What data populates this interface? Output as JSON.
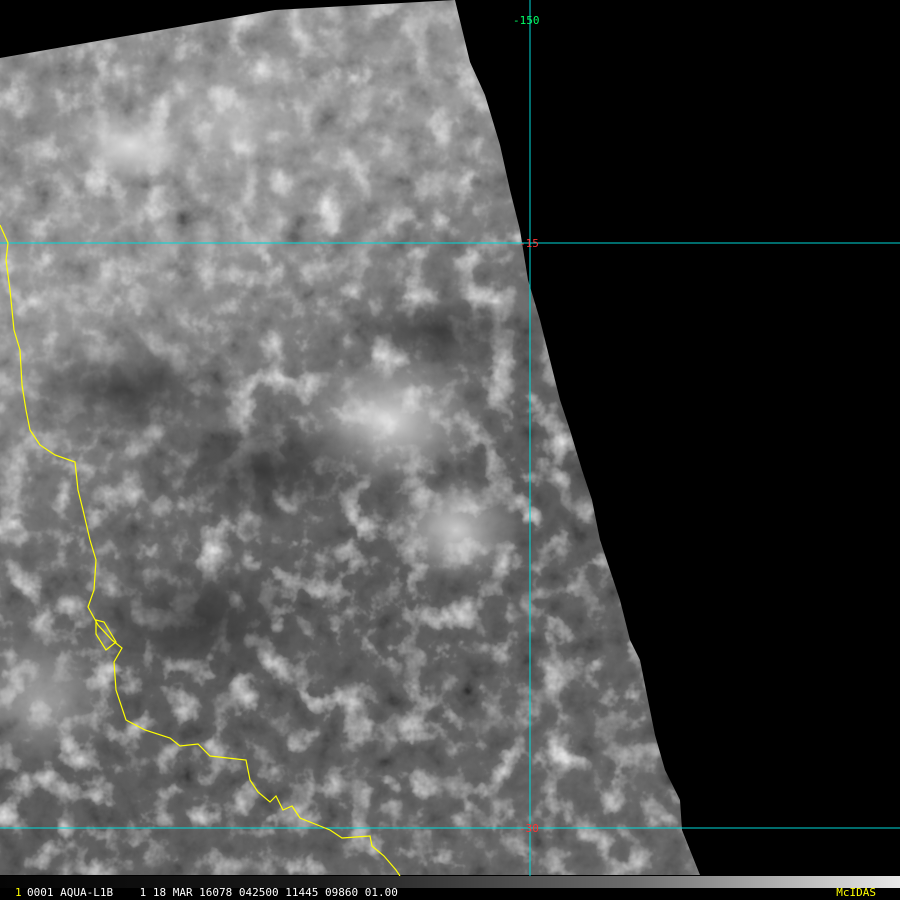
{
  "map": {
    "longitude_labels": [
      {
        "text": "-150",
        "color": "#00ff66"
      }
    ],
    "latitude_labels": [
      {
        "text": "-15",
        "color": "#ff3333"
      },
      {
        "text": "-30",
        "color": "#ff3333"
      }
    ],
    "colors": {
      "gridline": "#00d7d7",
      "coastline": "#ffff00",
      "background": "#000000"
    }
  },
  "status_bar": {
    "frame_marker": "1",
    "text": "0001 AQUA-L1B    1 18 MAR 16078 042500 11445 09860 01.00",
    "brand": "McIDAS"
  }
}
